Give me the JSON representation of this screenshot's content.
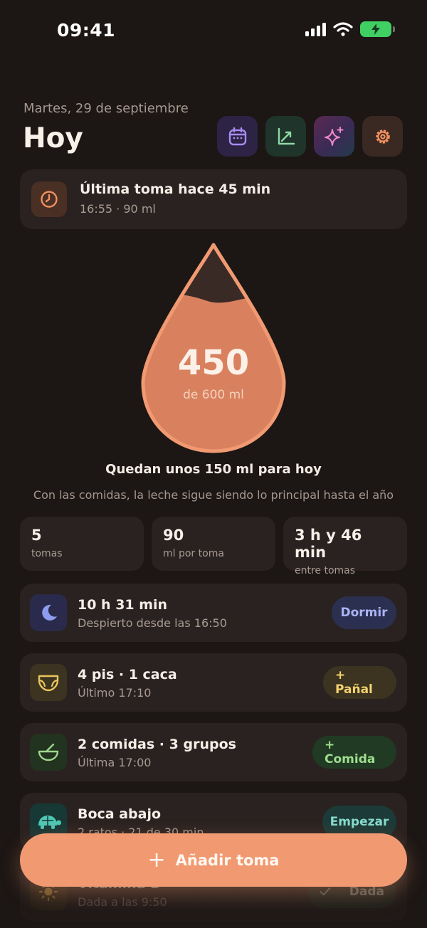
{
  "status": {
    "time": "09:41"
  },
  "header": {
    "date": "Martes, 29 de septiembre",
    "title": "Hoy",
    "actions": [
      "calendar-icon",
      "chart-icon",
      "sparkles-icon",
      "gear-icon"
    ]
  },
  "last_feed": {
    "title": "Última toma hace 45 min",
    "subtitle": "16:55 · 90 ml"
  },
  "drop": {
    "value": "450",
    "goal_label": "de 600 ml",
    "fill_fraction": 0.75
  },
  "remaining": "Quedan unos 150 ml para hoy",
  "hint": "Con las comidas, la leche sigue siendo lo principal hasta el año",
  "stats": [
    {
      "value": "5",
      "label": "tomas"
    },
    {
      "value": "90",
      "label": "ml por toma"
    },
    {
      "value": "3 h y 46 min",
      "label": "entre tomas"
    }
  ],
  "rows": {
    "sleep": {
      "title": "10 h 31 min",
      "subtitle": "Despierto desde las 16:50",
      "button": "Dormir",
      "icon": "moon-icon"
    },
    "diaper": {
      "title": "4 pis · 1 caca",
      "subtitle": "Último 17:10",
      "button": "+ Pañal",
      "icon": "diaper-icon"
    },
    "food": {
      "title": "2 comidas · 3 grupos",
      "subtitle": "Última 17:00",
      "button": "+ Comida",
      "icon": "bowl-icon"
    },
    "tummy": {
      "title": "Boca abajo",
      "subtitle": "2 ratos · 21 de 30 min",
      "button": "Empezar",
      "icon": "turtle-icon"
    },
    "vitamin": {
      "title": "Vitamina D",
      "subtitle": "Dada a las 9:50",
      "button": "Dada",
      "icon": "sun-icon"
    }
  },
  "fab": {
    "plus": "+",
    "label": "Añadir toma"
  },
  "colors": {
    "background": "#1c1614",
    "card": "#2a2220",
    "accent": "#f19a72"
  }
}
